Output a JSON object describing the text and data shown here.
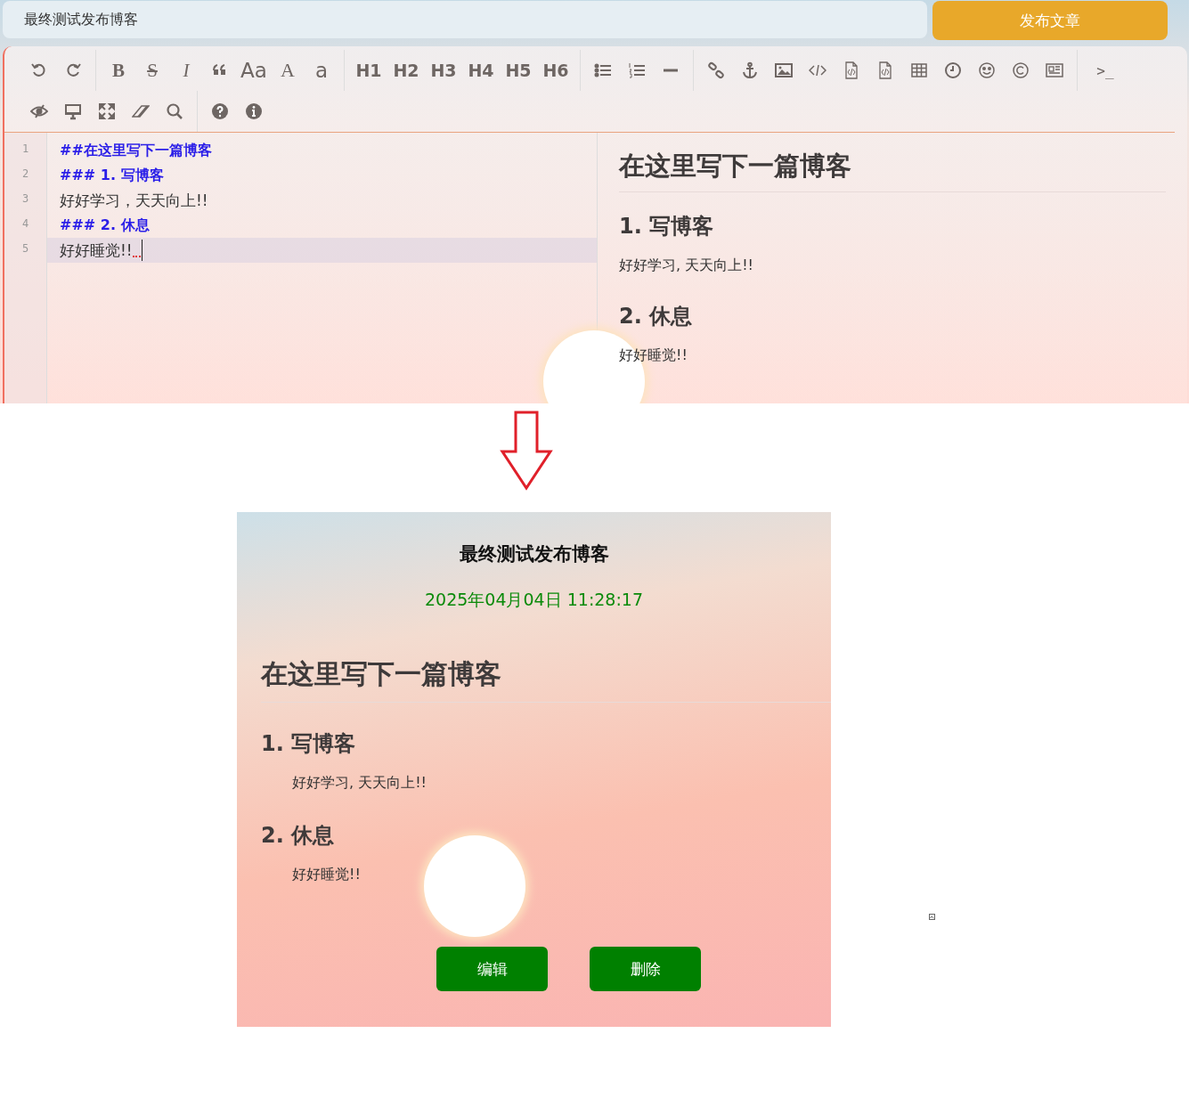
{
  "editor_page": {
    "title_field": {
      "value": "最终测试发布博客"
    },
    "publish_button": "发布文章",
    "toolbar": [
      [
        {
          "kind": "undo"
        },
        {
          "kind": "redo"
        }
      ],
      [
        {
          "kind": "bold",
          "label": "B"
        },
        {
          "kind": "strike",
          "label": "S"
        },
        {
          "kind": "italic",
          "label": "I"
        },
        {
          "kind": "quote"
        },
        {
          "kind": "sans",
          "label": "Aa"
        },
        {
          "kind": "serif",
          "label": "A"
        },
        {
          "kind": "sans",
          "label": "a"
        }
      ],
      [
        {
          "kind": "heading",
          "label": "H1"
        },
        {
          "kind": "heading",
          "label": "H2"
        },
        {
          "kind": "heading",
          "label": "H3"
        },
        {
          "kind": "heading",
          "label": "H4"
        },
        {
          "kind": "heading",
          "label": "H5"
        },
        {
          "kind": "heading",
          "label": "H6"
        }
      ],
      [
        {
          "kind": "bullets"
        },
        {
          "kind": "numbers"
        },
        {
          "kind": "rule"
        }
      ],
      [
        {
          "kind": "link"
        },
        {
          "kind": "anchor"
        },
        {
          "kind": "image"
        },
        {
          "kind": "code"
        },
        {
          "kind": "codefile"
        },
        {
          "kind": "codefile"
        },
        {
          "kind": "table"
        },
        {
          "kind": "clock"
        },
        {
          "kind": "smiley"
        },
        {
          "kind": "copyright"
        },
        {
          "kind": "newspaper"
        }
      ],
      [
        {
          "kind": "mono",
          "label": ">_"
        }
      ],
      [
        {
          "kind": "eyeslash"
        },
        {
          "kind": "desktop"
        },
        {
          "kind": "expand"
        },
        {
          "kind": "eraser"
        },
        {
          "kind": "search"
        }
      ],
      [
        {
          "kind": "question"
        },
        {
          "kind": "info"
        }
      ]
    ],
    "lines": [
      {
        "number": "1",
        "text": "##在这里写下一篇博客",
        "kind": "heading",
        "active": false
      },
      {
        "number": "2",
        "text": "### 1. 写博客",
        "kind": "heading",
        "active": false
      },
      {
        "number": "3",
        "text": "好好学习，天天向上!!",
        "kind": "plain",
        "active": false
      },
      {
        "number": "4",
        "text": "### 2. 休息",
        "kind": "heading",
        "active": false
      },
      {
        "number": "5",
        "text": "好好睡觉!!",
        "kind": "plain",
        "active": true
      }
    ],
    "preview": [
      {
        "kind": "h1",
        "text": "在这里写下一篇博客"
      },
      {
        "kind": "h2",
        "text": "1. 写博客"
      },
      {
        "kind": "p",
        "text": "好好学习, 天天向上!!"
      },
      {
        "kind": "h2",
        "text": "2. 休息"
      },
      {
        "kind": "p",
        "text": "好好睡觉!!"
      }
    ]
  },
  "result_page": {
    "title": "最终测试发布博客",
    "date": "2025年04月04日 11:28:17",
    "content": [
      {
        "kind": "h1",
        "text": "在这里写下一篇博客"
      },
      {
        "kind": "h2",
        "text": "1. 写博客"
      },
      {
        "kind": "p",
        "text": "好好学习, 天天向上!!"
      },
      {
        "kind": "h2",
        "text": "2. 休息"
      },
      {
        "kind": "p",
        "text": "好好睡觉!!"
      }
    ],
    "buttons": [
      "编辑",
      "删除"
    ]
  }
}
